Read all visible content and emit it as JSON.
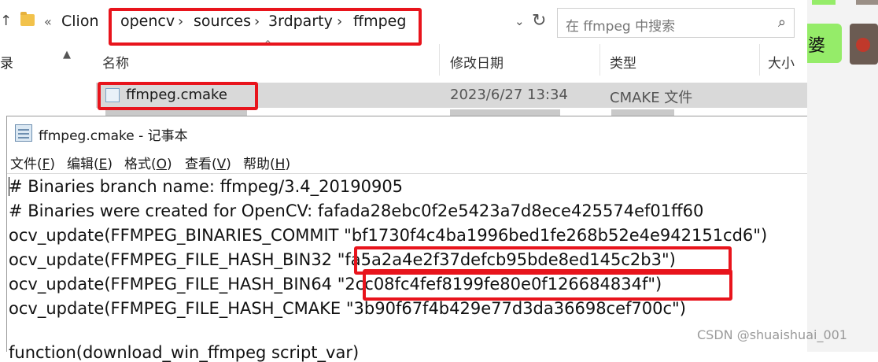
{
  "explorer": {
    "breadcrumb_more": "«",
    "breadcrumbs": [
      "Clion",
      "opencv",
      "sources",
      "3rdparty",
      "ffmpeg"
    ],
    "breadcrumb_separator": "›",
    "search_placeholder": "在 ffmpeg 中搜索",
    "left_pane_char": "录",
    "columns": {
      "name": "名称",
      "modified": "修改日期",
      "type": "类型",
      "size": "大小"
    },
    "file": {
      "name": "ffmpeg.cmake",
      "modified": "2023/6/27 13:34",
      "type": "CMAKE 文件"
    }
  },
  "chat": {
    "bubble_text": "婆"
  },
  "notepad": {
    "title": "ffmpeg.cmake - 记事本",
    "menu": [
      {
        "label": "文件",
        "key": "F"
      },
      {
        "label": "编辑",
        "key": "E"
      },
      {
        "label": "格式",
        "key": "O"
      },
      {
        "label": "查看",
        "key": "V"
      },
      {
        "label": "帮助",
        "key": "H"
      }
    ],
    "lines": [
      "# Binaries branch name: ffmpeg/3.4_20190905",
      "# Binaries were created for OpenCV: fafada28ebc0f2e5423a7d8ece425574ef01ff60",
      "ocv_update(FFMPEG_BINARIES_COMMIT \"bf1730f4c4ba1996bed1fe268b52e4e942151cd6\")",
      "ocv_update(FFMPEG_FILE_HASH_BIN32 \"fa5a2a4e2f37defcb95bde8ed145c2b3\")",
      "ocv_update(FFMPEG_FILE_HASH_BIN64 \"2cc08fc4fef8199fe80e0f126684834f\")",
      "ocv_update(FFMPEG_FILE_HASH_CMAKE \"3b90f67f4b429e77d3da36698cef700c\")",
      "",
      "function(download_win_ffmpeg script_var)"
    ]
  },
  "watermark": "CSDN @shuaishuai_001",
  "colors": {
    "highlight": "#e8141c",
    "selection": "#d9d9d9",
    "chat_green": "#95ec69"
  }
}
